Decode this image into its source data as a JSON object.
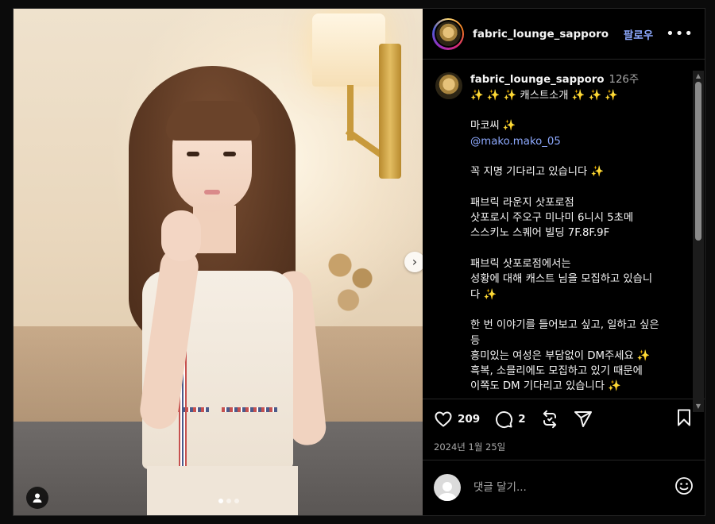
{
  "post": {
    "username": "fabric_lounge_sapporo",
    "follow_label": "팔로우",
    "more_label": "•••"
  },
  "caption": {
    "username": "fabric_lounge_sapporo",
    "time": "126주",
    "lines": [
      "✨ ✨ ✨ 캐스트소개 ✨ ✨ ✨",
      "",
      "마코씨 ✨",
      "@mako.mako_05",
      "",
      "꼭 지명 기다리고 있습니다 ✨",
      "",
      "패브릭 라운지 삿포로점",
      "삿포로시 주오구 미나미 6니시 5초메",
      "스스키노 스퀘어 빌딩 7F.8F.9F",
      "",
      "패브릭 삿포로점에서는",
      "성황에 대해 캐스트 님을 모집하고 있습니",
      "다 ✨",
      "",
      "한 번 이야기를 들어보고 싶고, 일하고 싶은",
      "등",
      "흥미있는 여성은 부담없이 DM주세요 ✨",
      "흑복, 소믈리에도 모집하고 있기 때문에",
      "이쪽도 DM 기다리고 있습니다 ✨"
    ]
  },
  "actions": {
    "likes": "209",
    "comments": "2"
  },
  "date": "2024년 1월 25일",
  "comment_box": {
    "placeholder": "댓글 달기..."
  },
  "carousel": {
    "total": 3,
    "active": 0
  },
  "colors": {
    "link": "#8eaaff",
    "background": "#000000",
    "muted": "#a8a8a8"
  },
  "icons": [
    "heart-icon",
    "comment-icon",
    "repost-icon",
    "share-icon",
    "bookmark-icon",
    "emoji-icon",
    "chevron-right-icon",
    "user-tag-icon",
    "more-icon"
  ]
}
